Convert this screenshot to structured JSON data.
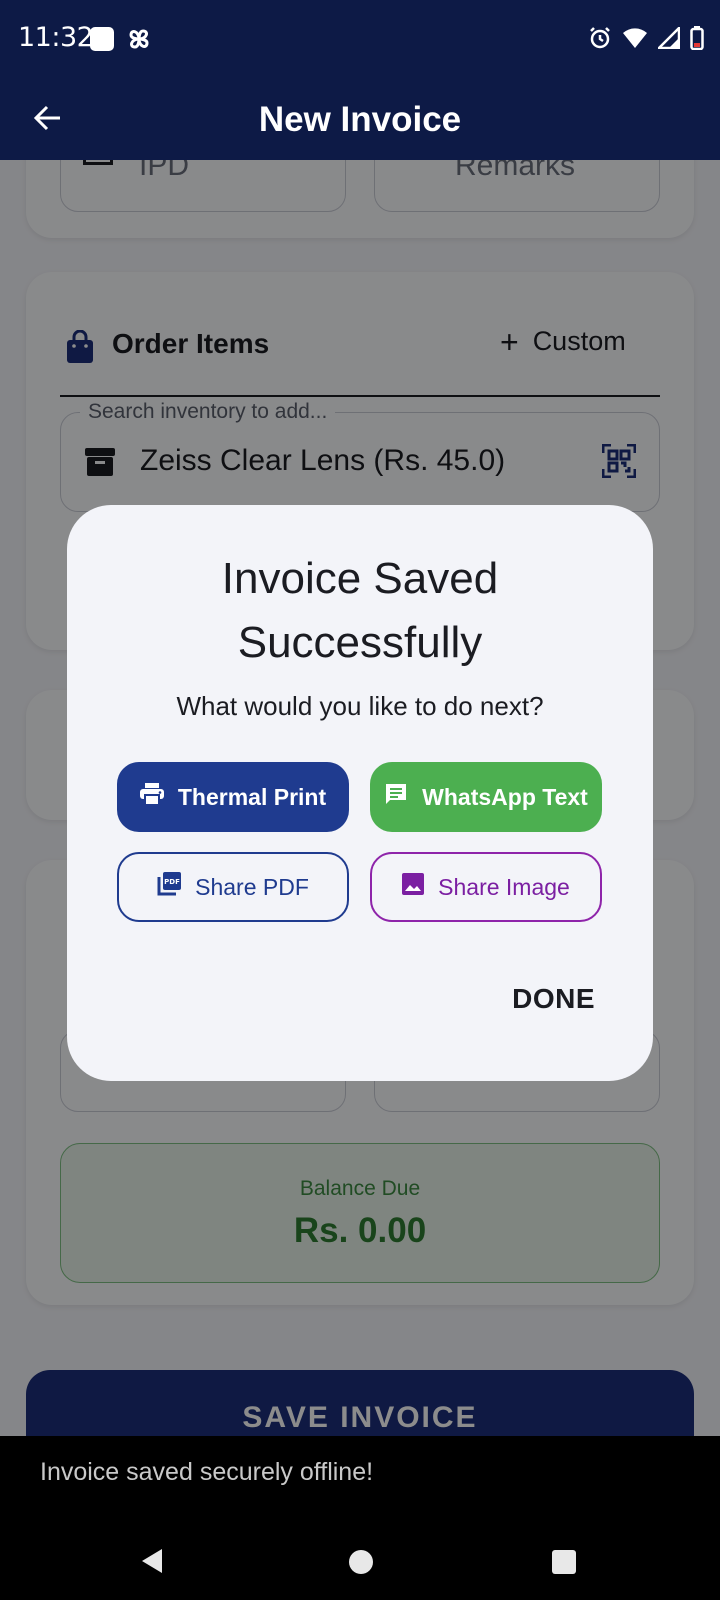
{
  "status_bar": {
    "time": "11:32"
  },
  "app_bar": {
    "title": "New Invoice"
  },
  "form": {
    "ipd_field": "IPD",
    "remarks_field": "Remarks"
  },
  "order_items": {
    "title": "Order Items",
    "custom_label": "Custom",
    "search_label": "Search inventory to add...",
    "item_text": "Zeiss Clear Lens (Rs. 45.0)"
  },
  "balance": {
    "label": "Balance Due",
    "value": "Rs. 0.00"
  },
  "save_button": "SAVE INVOICE",
  "dialog": {
    "title_line1": "Invoice Saved",
    "title_line2": "Successfully",
    "subtitle": "What would you like to do next?",
    "thermal_print": "Thermal Print",
    "whatsapp_text": "WhatsApp Text",
    "share_pdf": "Share PDF",
    "share_image": "Share Image",
    "done": "DONE"
  },
  "snackbar": {
    "message": "Invoice saved securely offline!"
  },
  "colors": {
    "app_bar": "#0d1a46",
    "primary": "#1f3b8f",
    "whatsapp": "#4caf50",
    "share_image": "#8e24aa",
    "balance_green": "#2e7d32"
  }
}
